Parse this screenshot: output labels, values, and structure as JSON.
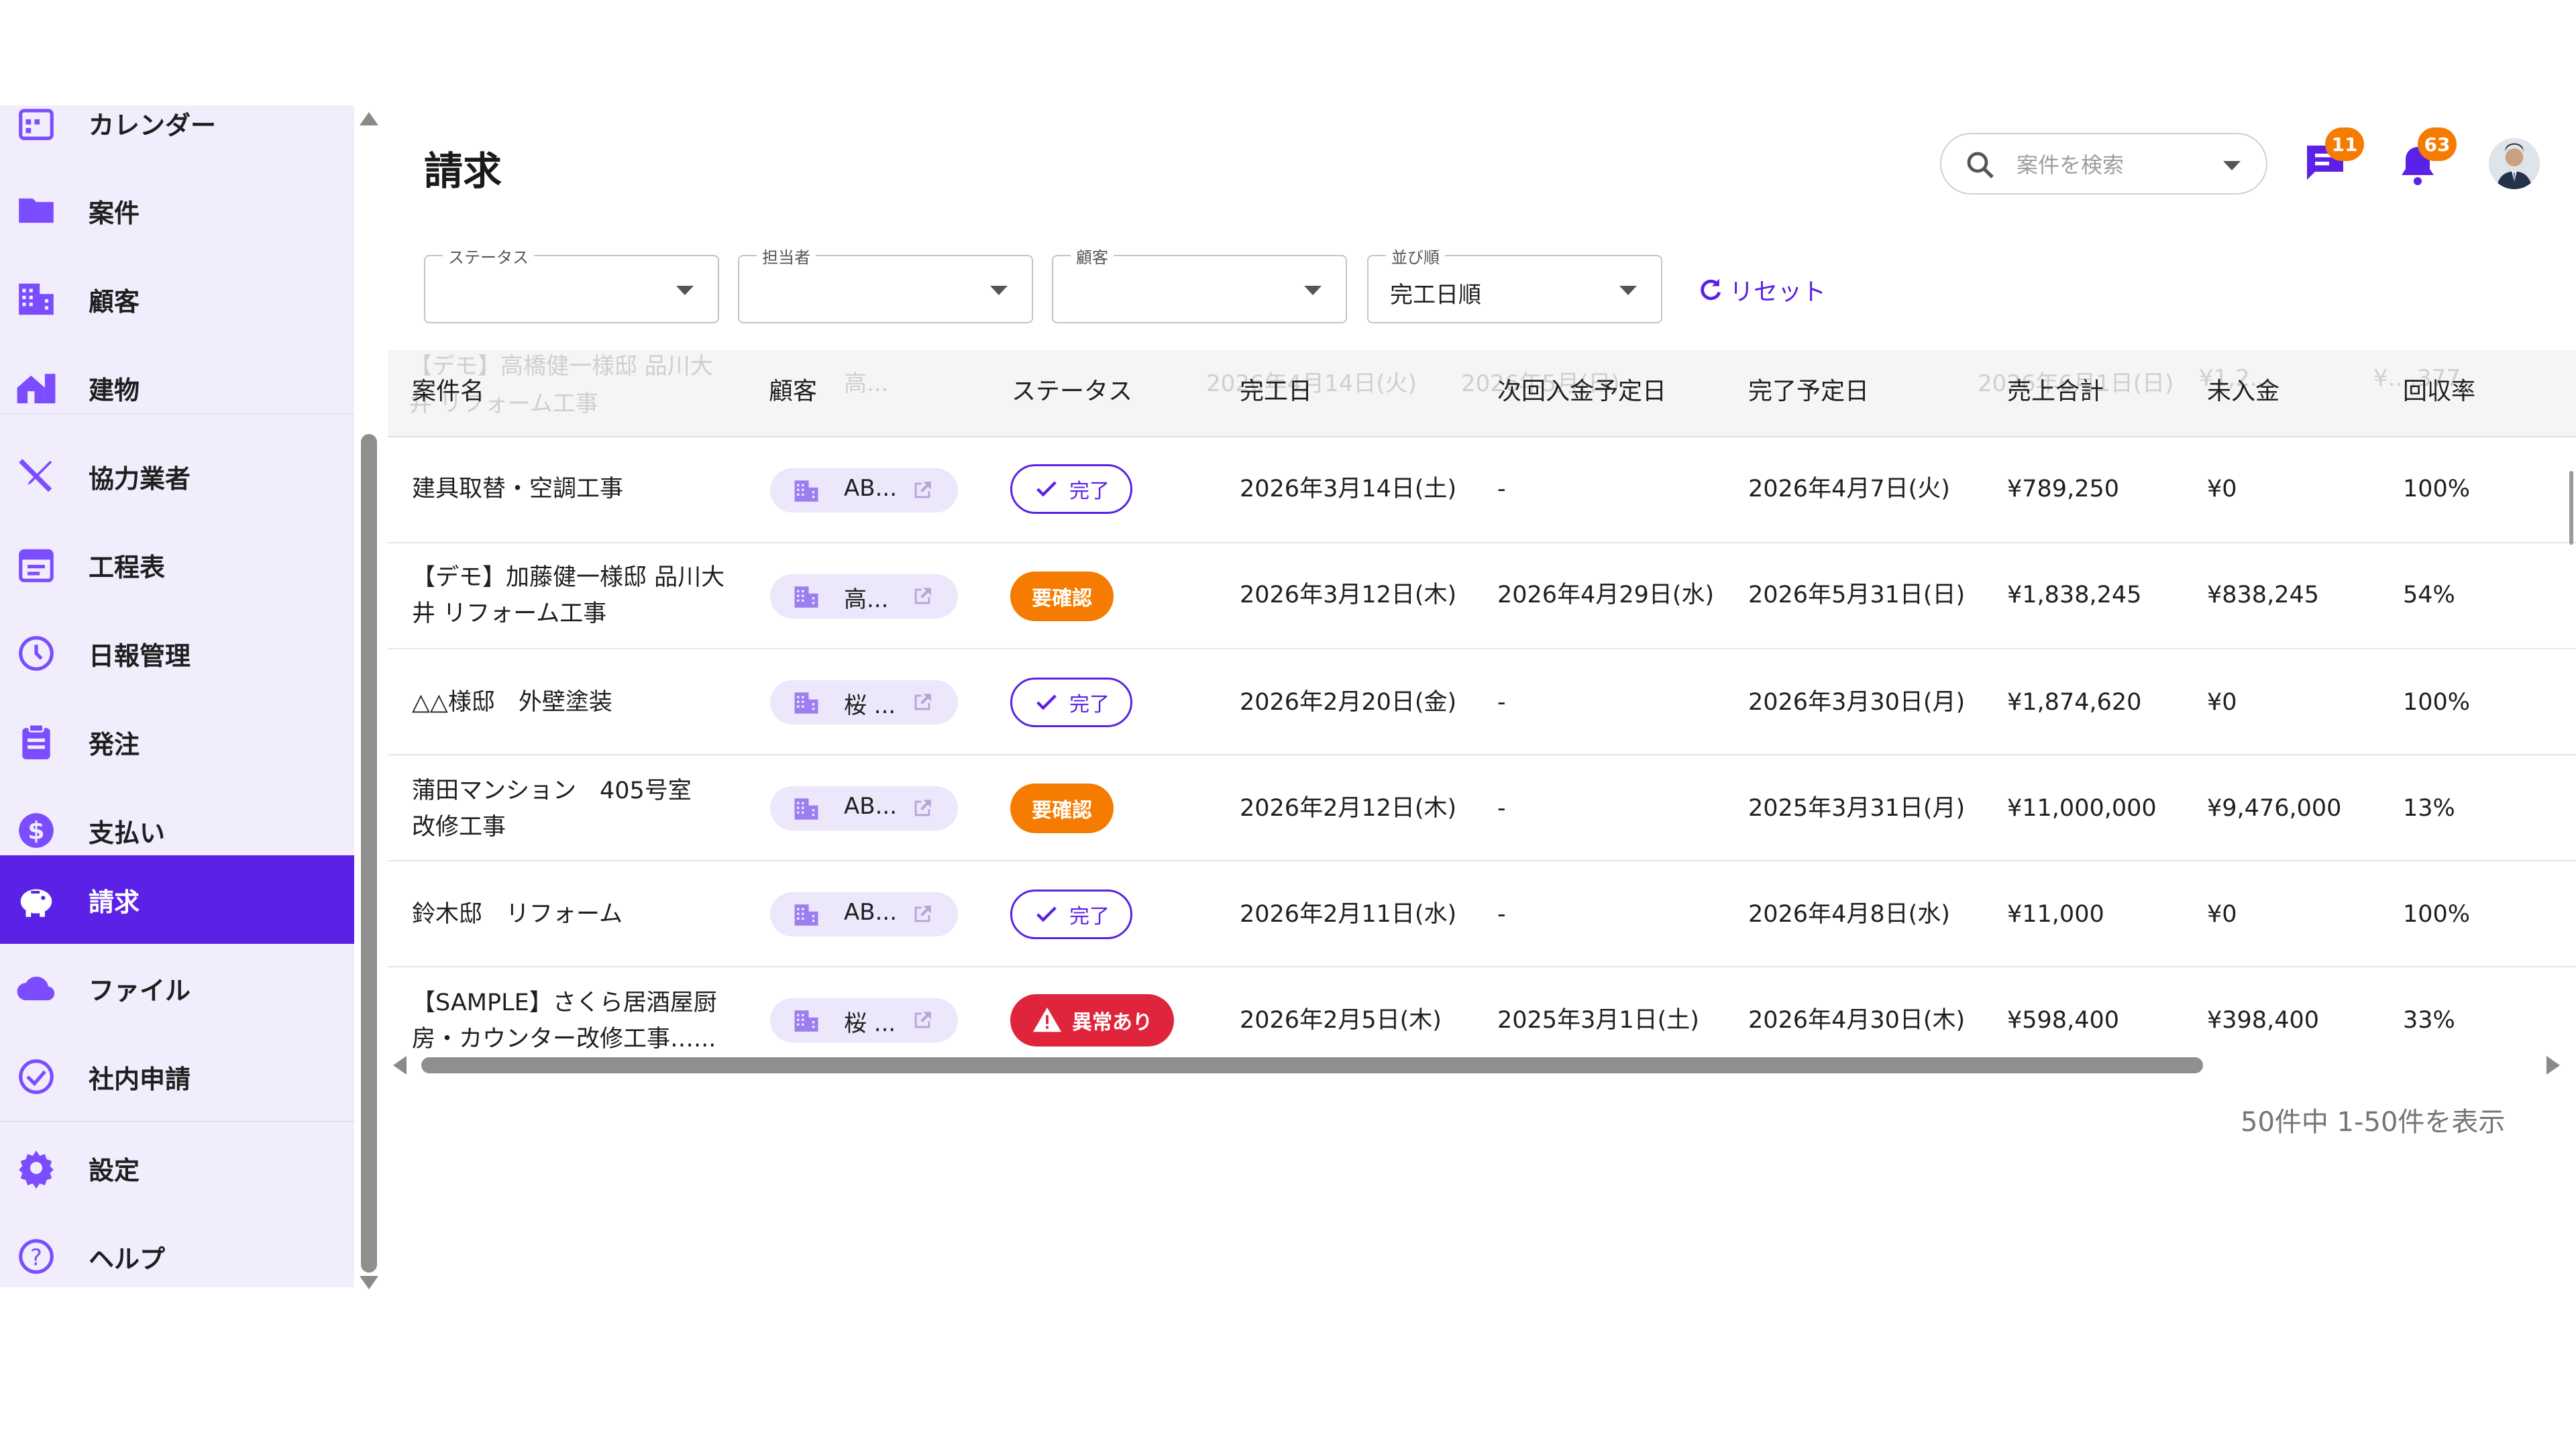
{
  "sidebar": {
    "items": [
      {
        "label": "カレンダー",
        "icon": "calendar-icon"
      },
      {
        "label": "案件",
        "icon": "folder-icon"
      },
      {
        "label": "顧客",
        "icon": "building-icon"
      },
      {
        "label": "建物",
        "icon": "house-icon"
      },
      {
        "label": "協力業者",
        "icon": "tools-icon"
      },
      {
        "label": "工程表",
        "icon": "schedule-icon"
      },
      {
        "label": "日報管理",
        "icon": "clock-icon"
      },
      {
        "label": "発注",
        "icon": "clipboard-icon"
      },
      {
        "label": "支払い",
        "icon": "dollar-icon"
      },
      {
        "label": "請求",
        "icon": "piggy-bank-icon",
        "active": true
      },
      {
        "label": "ファイル",
        "icon": "cloud-icon"
      },
      {
        "label": "社内申請",
        "icon": "check-circle-icon"
      },
      {
        "label": "設定",
        "icon": "gear-icon"
      },
      {
        "label": "ヘルプ",
        "icon": "help-icon"
      }
    ]
  },
  "header": {
    "title": "請求",
    "search_placeholder": "案件を検索",
    "chat_badge": "11",
    "notification_badge": "63"
  },
  "filters": {
    "status_label": "ステータス",
    "status_value": "",
    "assignee_label": "担当者",
    "assignee_value": "",
    "customer_label": "顧客",
    "customer_value": "",
    "sort_label": "並び順",
    "sort_value": "完工日順",
    "reset_label": "リセット"
  },
  "table": {
    "columns": [
      "案件名",
      "顧客",
      "ステータス",
      "完工日",
      "次回入金予定日",
      "完了予定日",
      "売上合計",
      "未入金",
      "回収率"
    ],
    "ghost_row": {
      "name1": "【デモ】高橋健一様邸 品川大",
      "name2": "井 リフォーム工事",
      "customer": "高...",
      "date": "2026年4月14日(火)",
      "next": "2026年5月(日)",
      "due": "2026年6月1日(日)",
      "sales": "¥1,2...",
      "unpaid": "¥...,377"
    },
    "rows": [
      {
        "name": [
          "建具取替・空調工事"
        ],
        "customer": "AB...",
        "status": "完了",
        "status_type": "done",
        "completed": "2026年3月14日(土)",
        "next_payment": "-",
        "due": "2026年4月7日(火)",
        "sales": "¥789,250",
        "unpaid": "¥0",
        "rate": "100%"
      },
      {
        "name": [
          "【デモ】加藤健一様邸 品川大",
          "井 リフォーム工事"
        ],
        "customer": "高...",
        "status": "要確認",
        "status_type": "check",
        "completed": "2026年3月12日(木)",
        "next_payment": "2026年4月29日(水)",
        "due": "2026年5月31日(日)",
        "sales": "¥1,838,245",
        "unpaid": "¥838,245",
        "rate": "54%"
      },
      {
        "name": [
          "△△様邸　外壁塗装"
        ],
        "customer": "桜 ...",
        "status": "完了",
        "status_type": "done",
        "completed": "2026年2月20日(金)",
        "next_payment": "-",
        "due": "2026年3月30日(月)",
        "sales": "¥1,874,620",
        "unpaid": "¥0",
        "rate": "100%"
      },
      {
        "name": [
          "蒲田マンション　405号室",
          "改修工事"
        ],
        "customer": "AB...",
        "status": "要確認",
        "status_type": "check",
        "completed": "2026年2月12日(木)",
        "next_payment": "-",
        "due": "2025年3月31日(月)",
        "sales": "¥11,000,000",
        "unpaid": "¥9,476,000",
        "rate": "13%"
      },
      {
        "name": [
          "鈴木邸　リフォーム"
        ],
        "customer": "AB...",
        "status": "完了",
        "status_type": "done",
        "completed": "2026年2月11日(水)",
        "next_payment": "-",
        "due": "2026年4月8日(水)",
        "sales": "¥11,000",
        "unpaid": "¥0",
        "rate": "100%"
      },
      {
        "name": [
          "【SAMPLE】さくら居酒屋厨",
          "房・カウンター改修工事…..."
        ],
        "customer": "桜 ...",
        "status": "異常あり",
        "status_type": "error",
        "completed": "2026年2月5日(木)",
        "next_payment": "2025年3月1日(土)",
        "due": "2026年4月30日(木)",
        "sales": "¥598,400",
        "unpaid": "¥398,400",
        "rate": "33%"
      }
    ]
  },
  "pagination": {
    "summary": "50件中 1-50件を表示"
  },
  "colors": {
    "accent": "#5b21e6",
    "sidebar_bg": "#f1edfd",
    "warning": "#f57c00",
    "error": "#e0243c"
  }
}
